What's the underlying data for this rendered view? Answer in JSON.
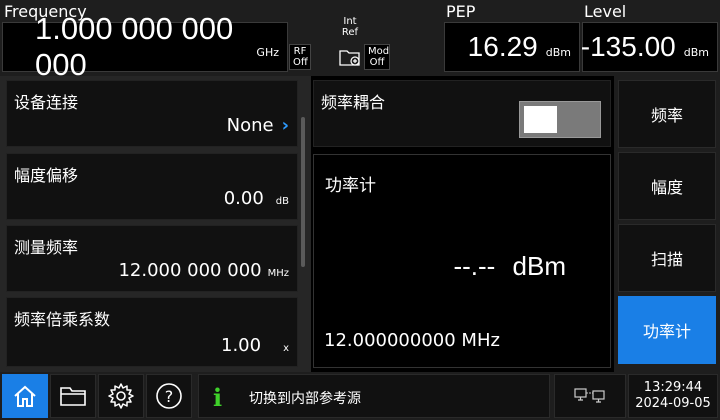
{
  "header": {
    "frequency_label": "Frequency",
    "frequency_value": "1.000 000 000 000",
    "frequency_unit": "GHz",
    "rf_label": "RF",
    "rf_state": "Off",
    "ref_line1": "Int",
    "ref_line2": "Ref",
    "mod_label": "Mod",
    "mod_state": "Off",
    "pep_label": "PEP",
    "pep_value": "16.29",
    "pep_unit": "dBm",
    "level_label": "Level",
    "level_value": "-135.00",
    "level_unit": "dBm"
  },
  "left_panel": {
    "items": [
      {
        "title": "设备连接",
        "value": "None",
        "unit": "",
        "chevron": "›"
      },
      {
        "title": "幅度偏移",
        "value": "0.00",
        "unit": "dB"
      },
      {
        "title": "测量频率",
        "value": "12.000 000 000",
        "unit": "MHz"
      },
      {
        "title": "频率倍乘系数",
        "value": "1.00",
        "unit": "x"
      }
    ]
  },
  "coupling": {
    "title": "频率耦合",
    "toggle_on": false
  },
  "power_meter": {
    "title": "功率计",
    "reading": "--.--",
    "reading_unit": "dBm",
    "frequency": "12.000000000  MHz"
  },
  "right_menu": {
    "items": [
      "频率",
      "幅度",
      "扫描",
      "功率计"
    ],
    "active_index": 3,
    "active_color": "#1a7fe6"
  },
  "bottom_bar": {
    "icons": [
      "home-icon",
      "folder-icon",
      "gear-icon",
      "help-icon"
    ],
    "info_glyph": "i",
    "status_message": "切换到内部参考源",
    "time": "13:29:44",
    "date": "2024-09-05"
  }
}
